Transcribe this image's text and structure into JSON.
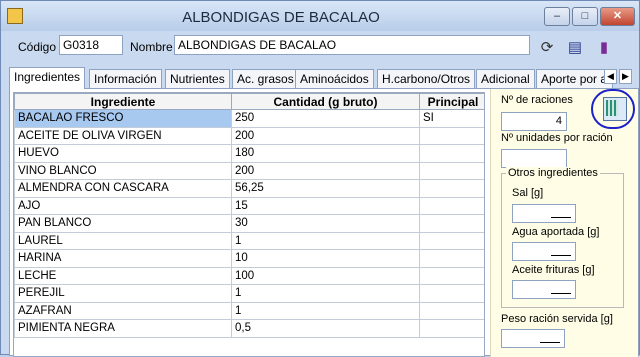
{
  "window": {
    "title": "ALBONDIGAS DE BACALAO",
    "minimize": "–",
    "maximize": "□",
    "close": "✕"
  },
  "header": {
    "codigo_label": "Código",
    "codigo_value": "G0318",
    "nombre_label": "Nombre",
    "nombre_value": "ALBONDIGAS DE BACALAO"
  },
  "tabs": [
    {
      "label": "Ingredientes"
    },
    {
      "label": "Información"
    },
    {
      "label": "Nutrientes"
    },
    {
      "label": "Ac. grasos"
    },
    {
      "label": "Aminoácidos"
    },
    {
      "label": "H.carbono/Otros"
    },
    {
      "label": "Adicional"
    },
    {
      "label": "Aporte por a"
    }
  ],
  "table": {
    "headers": [
      "Ingrediente",
      "Cantidad (g bruto)",
      "Principal"
    ],
    "rows": [
      [
        "BACALAO FRESCO",
        "250",
        "SI"
      ],
      [
        "ACEITE DE OLIVA VIRGEN",
        "200",
        ""
      ],
      [
        "HUEVO",
        "180",
        ""
      ],
      [
        "VINO BLANCO",
        "200",
        ""
      ],
      [
        "ALMENDRA CON CASCARA",
        "56,25",
        ""
      ],
      [
        "AJO",
        "15",
        ""
      ],
      [
        "PAN BLANCO",
        "30",
        ""
      ],
      [
        "LAUREL",
        "1",
        ""
      ],
      [
        "HARINA",
        "10",
        ""
      ],
      [
        "LECHE",
        "100",
        ""
      ],
      [
        "PEREJIL",
        "1",
        ""
      ],
      [
        "AZAFRAN",
        "1",
        ""
      ],
      [
        "PIMIENTA NEGRA",
        "0,5",
        ""
      ]
    ]
  },
  "side": {
    "raciones_label": "Nº de raciones",
    "raciones_value": "4",
    "unidades_label": "Nº unidades por ración",
    "unidades_value": "",
    "otros_title": "Otros ingredientes",
    "sal_label": "Sal [g]",
    "agua_label": "Agua aportada [g]",
    "aceite_label": "Aceite frituras [g]",
    "peso_label": "Peso ración servida [g]"
  }
}
